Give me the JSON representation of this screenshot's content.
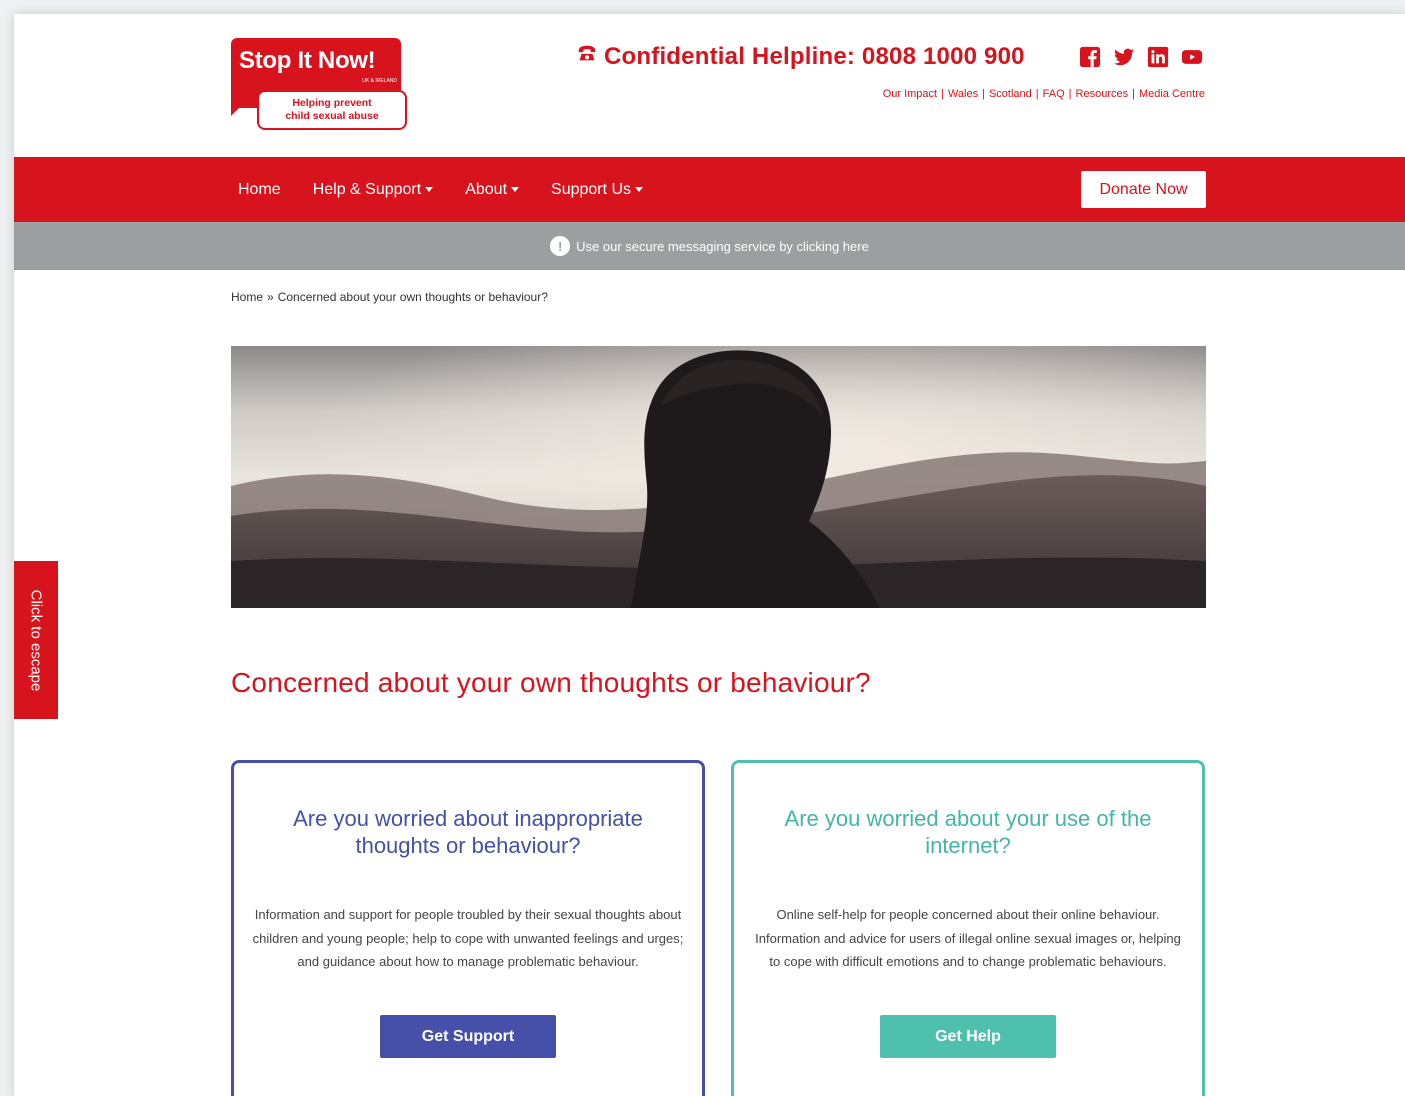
{
  "logo": {
    "title": "Stop It Now!",
    "subtitle": "UK & IRELAND",
    "tagline_line1": "Helping prevent",
    "tagline_line2": "child sexual abuse"
  },
  "helpline": {
    "text": "Confidential Helpline: 0808 1000 900",
    "icon": "phone-icon"
  },
  "socials": [
    "facebook-icon",
    "twitter-icon",
    "linkedin-icon",
    "youtube-icon"
  ],
  "top_links": [
    "Our Impact",
    "Wales",
    "Scotland",
    "FAQ",
    "Resources",
    "Media Centre"
  ],
  "nav": {
    "items": [
      {
        "label": "Home",
        "has_dropdown": false
      },
      {
        "label": "Help & Support",
        "has_dropdown": true
      },
      {
        "label": "About",
        "has_dropdown": true
      },
      {
        "label": "Support Us",
        "has_dropdown": true
      }
    ],
    "donate_label": "Donate Now"
  },
  "message_bar": {
    "text": "Use our secure messaging service by clicking here"
  },
  "breadcrumb": {
    "home": "Home",
    "separator": "»",
    "current": "Concerned about your own thoughts or behaviour?"
  },
  "escape": {
    "label": "Click to escape"
  },
  "page_title": "Concerned about your own thoughts or behaviour?",
  "cards": [
    {
      "title": "Are you worried about inappropriate thoughts or behaviour?",
      "body": "Information and support for people troubled by their sexual thoughts about children and young people; help to cope with unwanted feelings and urges; and guidance about how to manage problematic behaviour.",
      "button": "Get Support"
    },
    {
      "title": "Are you worried about your use of the internet?",
      "body": "Online self-help for people concerned about their online behaviour. Information and advice for users of illegal online sexual images or, helping to cope with difficult emotions and to change problematic behaviours.",
      "button": "Get Help"
    }
  ],
  "colors": {
    "brand_red": "#d7141e",
    "card1_blue": "#4650a8",
    "card2_teal": "#4fc0ae",
    "message_bar_grey": "#9d9ea0"
  }
}
